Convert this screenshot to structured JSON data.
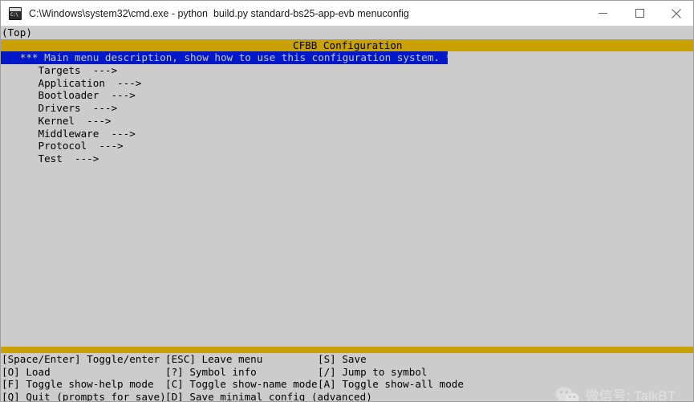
{
  "window": {
    "title": "C:\\Windows\\system32\\cmd.exe - python  build.py standard-bs25-app-evb menuconfig",
    "icon_label": "C:\\",
    "minimize_label": "Minimize",
    "maximize_label": "Maximize",
    "close_label": "Close"
  },
  "console": {
    "scroll_indicator": "(Top)",
    "menu_title": "CFBB Configuration",
    "selected_row": "   *** Main menu description, show how to use this configuration system. ***",
    "items": [
      "      Targets  --->",
      "      Application  --->",
      "      Bootloader  --->",
      "      Drivers  --->",
      "      Kernel  --->",
      "      Middleware  --->",
      "      Protocol  --->",
      "      Test  --->"
    ],
    "help_lines": [
      {
        "col1": "[Space/Enter] Toggle/enter",
        "col2": "[ESC] Leave menu",
        "col3": "[S] Save"
      },
      {
        "col1": "[O] Load",
        "col2": "[?] Symbol info",
        "col3": "[/] Jump to symbol"
      },
      {
        "col1": "[F] Toggle show-help mode",
        "col2": "[C] Toggle show-name mode",
        "col3": "[A] Toggle show-all mode"
      },
      {
        "col1": "[Q] Quit (prompts for save)",
        "col2": "[D] Save minimal config (advanced)",
        "col3": ""
      }
    ]
  },
  "watermark": {
    "text": "微信号: TalkBT"
  },
  "colors": {
    "gold_bar": "#c9a100",
    "selection_blue": "#0018c8",
    "console_bg": "#cccccc",
    "text": "#000000"
  }
}
